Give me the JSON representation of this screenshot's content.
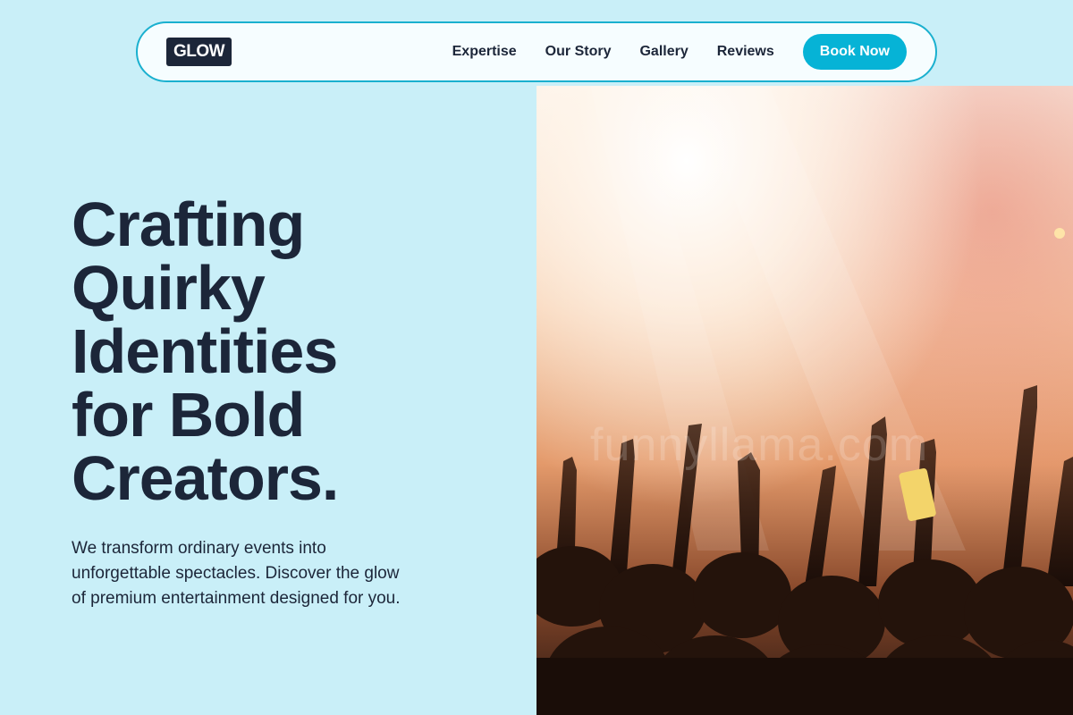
{
  "nav": {
    "logo": "GLOW",
    "links": [
      "Expertise",
      "Our Story",
      "Gallery",
      "Reviews"
    ],
    "cta": "Book Now"
  },
  "hero": {
    "title_lines": [
      "Crafting",
      "Quirky",
      "Identities",
      "for Bold",
      "Creators."
    ],
    "subtitle_lines": [
      "We transform ordinary events into",
      "unforgettable spectacles. Discover the glow",
      "of premium entertainment designed for you."
    ],
    "image_watermark": "funnyllama.com"
  },
  "colors": {
    "background": "#c9eff8",
    "nav_border": "#1ab0cf",
    "accent": "#06b3d6",
    "text": "#1c2639"
  }
}
